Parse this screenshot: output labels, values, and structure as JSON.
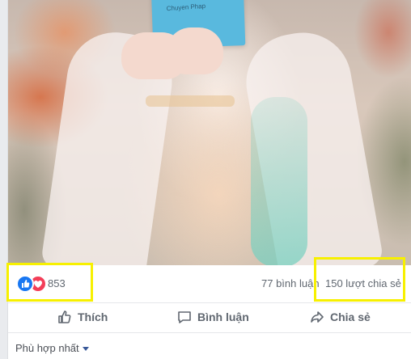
{
  "post": {
    "photo": {
      "book_title": "Chuyen Phap"
    },
    "stats": {
      "reaction_count": "853",
      "reaction_icons": [
        "like-icon",
        "love-icon"
      ],
      "comments_label": "77 bình luận",
      "shares_label": "150 lượt chia sẻ"
    },
    "actions": {
      "like_label": "Thích",
      "comment_label": "Bình luận",
      "share_label": "Chia sẻ"
    },
    "comments_sort": {
      "selected": "Phù hợp nhất"
    }
  },
  "colors": {
    "facebook_blue": "#1877f2",
    "love_red": "#f33e58",
    "highlight_yellow": "#f7f000",
    "secondary_text": "#606770"
  }
}
